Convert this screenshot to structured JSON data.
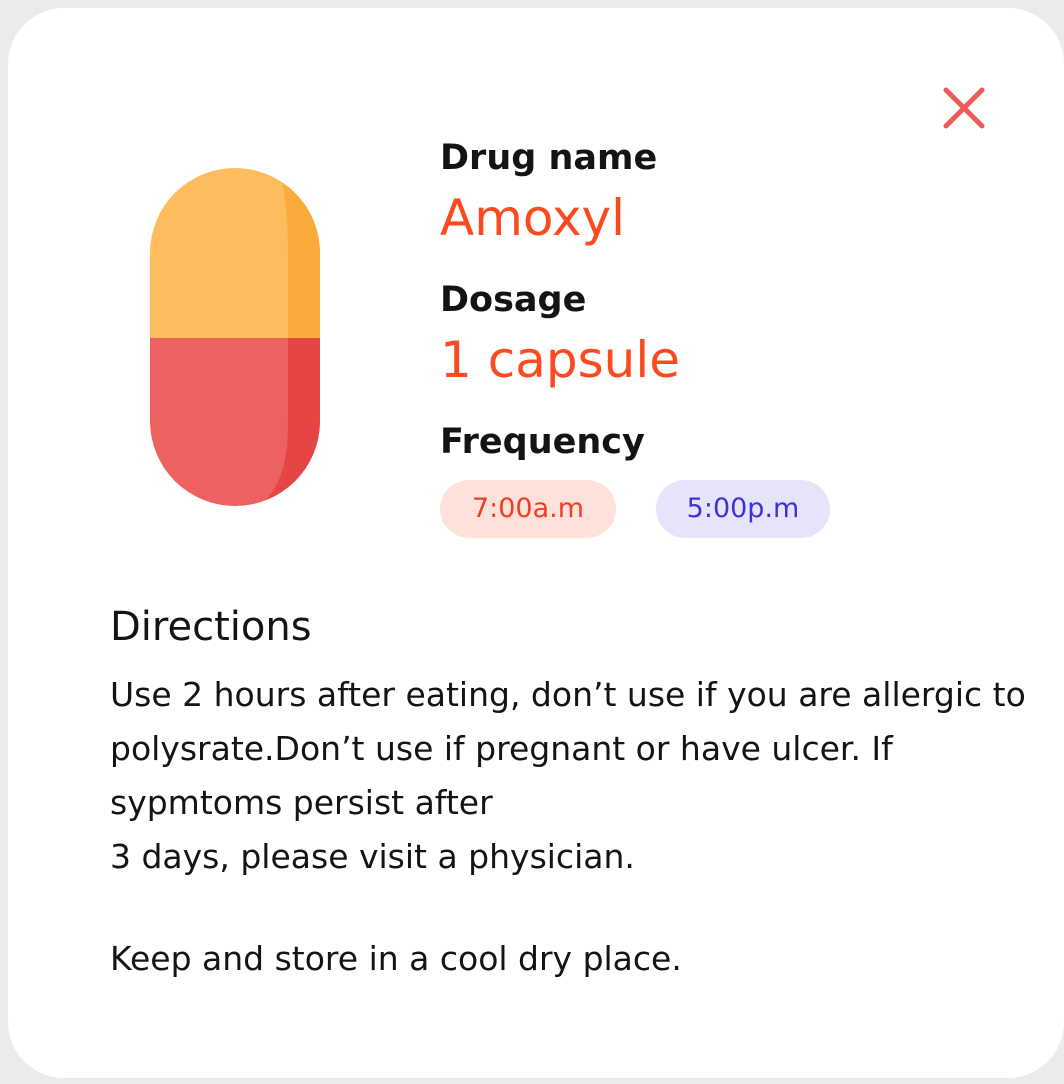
{
  "card": {
    "close_icon": "close-icon",
    "pill_icon": "capsule-icon"
  },
  "drug": {
    "name_label": "Drug name",
    "name_value": "Amoxyl",
    "dosage_label": "Dosage",
    "dosage_value": "1 capsule",
    "frequency_label": "Frequency",
    "times": [
      {
        "label": "7:00a.m"
      },
      {
        "label": "5:00p.m"
      }
    ]
  },
  "directions": {
    "title": "Directions",
    "text": "Use 2 hours after eating, don’t use if you are allergic to polysrate.Don’t use if pregnant or have ulcer. If sypmtoms persist after\n3 days, please visit a physician.",
    "note": "Keep and store in a cool dry place."
  },
  "colors": {
    "accent": "#fb4a1d",
    "close": "#f05a5a",
    "chip_am_bg": "#fde2dc",
    "chip_am_text": "#f03e24",
    "chip_pm_bg": "#e6e4fb",
    "chip_pm_text": "#3e33d8",
    "pill_top": "#fdbd5e",
    "pill_top_shade": "#fbaa3c",
    "pill_bottom": "#ee6161",
    "pill_bottom_shade": "#e64545"
  }
}
